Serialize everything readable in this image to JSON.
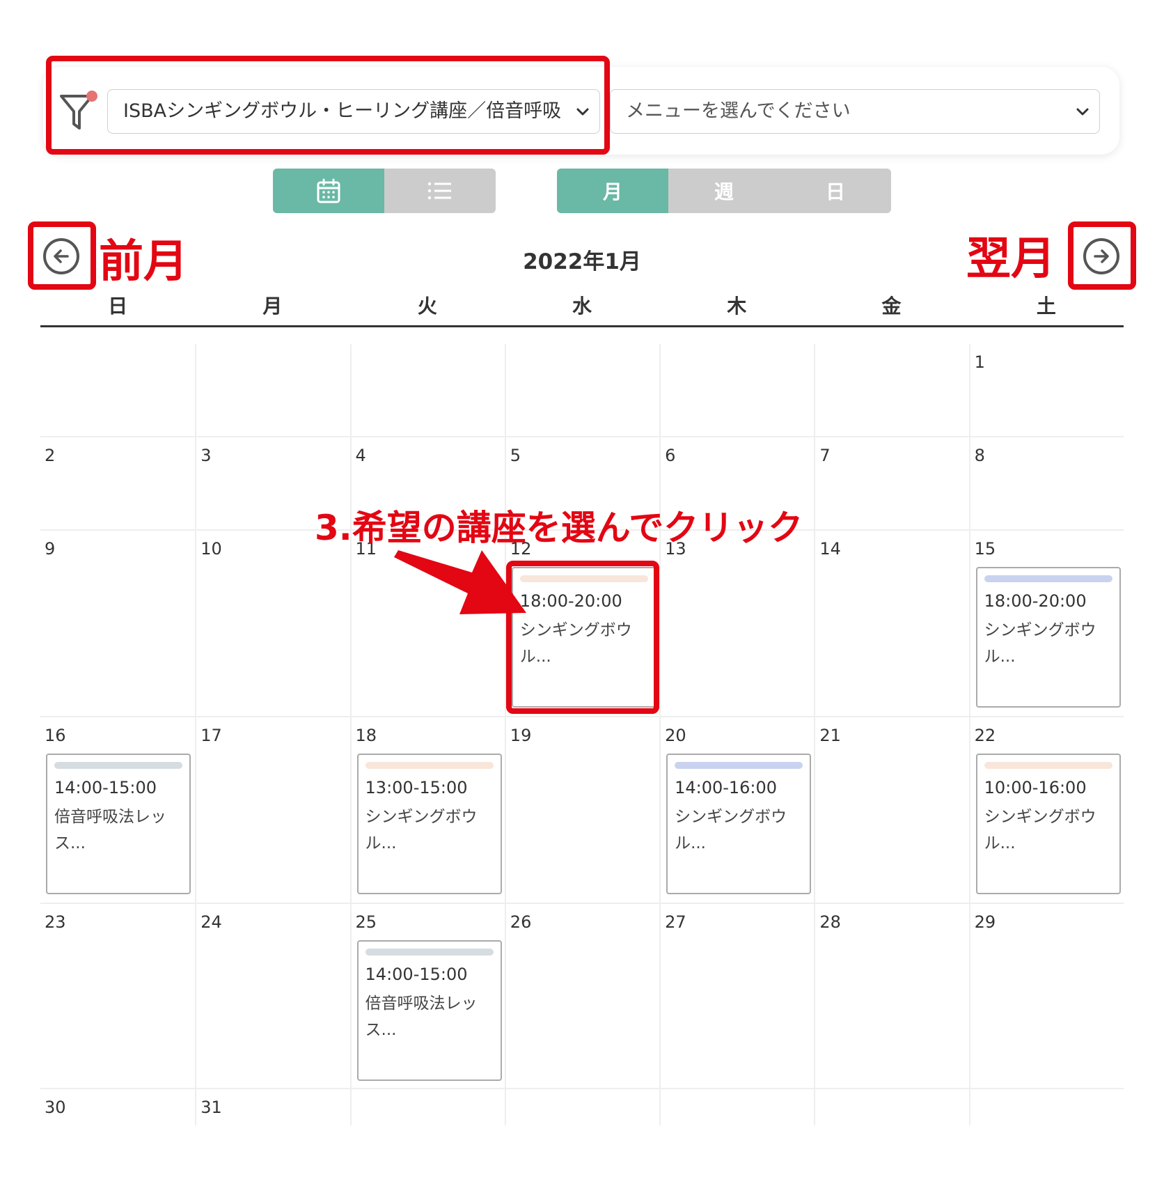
{
  "filter": {
    "course_select_value": "ISBAシンギングボウル・ヒーリング講座／倍音呼吸",
    "menu_select_placeholder": "メニューを選んでください"
  },
  "view_toggle": {
    "calendar_icon": "calendar-icon",
    "list_icon": "list-icon"
  },
  "range_toggle": {
    "month": "月",
    "week": "週",
    "day": "日",
    "active": "月"
  },
  "header": {
    "title": "2022年1月",
    "prev_icon": "arrow-left-circle-icon",
    "next_icon": "arrow-right-circle-icon"
  },
  "weekdays": [
    "日",
    "月",
    "火",
    "水",
    "木",
    "金",
    "土"
  ],
  "colors": {
    "accent": "#6ab8a6",
    "inactive": "#cccccc",
    "annotation": "#e30613",
    "bar_peach": "#f8e6da",
    "bar_blue": "#c9d3f0",
    "bar_gray": "#d6dde0"
  },
  "weeks": [
    [
      "",
      "",
      "",
      "",
      "",
      "",
      "1"
    ],
    [
      "2",
      "3",
      "4",
      "5",
      "6",
      "7",
      "8"
    ],
    [
      "9",
      "10",
      "11",
      "12",
      "13",
      "14",
      "15"
    ],
    [
      "16",
      "17",
      "18",
      "19",
      "20",
      "21",
      "22"
    ],
    [
      "23",
      "24",
      "25",
      "26",
      "27",
      "28",
      "29"
    ],
    [
      "30",
      "31",
      "",
      "",
      "",
      "",
      ""
    ]
  ],
  "events": [
    {
      "week": 2,
      "day": 3,
      "time": "18:00-20:00",
      "title": "シンギングボウル...",
      "color": "#f8e6da"
    },
    {
      "week": 2,
      "day": 6,
      "time": "18:00-20:00",
      "title": "シンギングボウル...",
      "color": "#c9d3f0"
    },
    {
      "week": 3,
      "day": 0,
      "time": "14:00-15:00",
      "title": "倍音呼吸法レッス...",
      "color": "#d6dde0"
    },
    {
      "week": 3,
      "day": 2,
      "time": "13:00-15:00",
      "title": "シンギングボウル...",
      "color": "#f8e6da"
    },
    {
      "week": 3,
      "day": 4,
      "time": "14:00-16:00",
      "title": "シンギングボウル...",
      "color": "#c9d3f0"
    },
    {
      "week": 3,
      "day": 6,
      "time": "10:00-16:00",
      "title": "シンギングボウル...",
      "color": "#f8e6da"
    },
    {
      "week": 4,
      "day": 2,
      "time": "14:00-15:00",
      "title": "倍音呼吸法レッス...",
      "color": "#d6dde0"
    }
  ],
  "annotations": {
    "prev_month": "前月",
    "next_month": "翌月",
    "instruction": "3.希望の講座を選んでクリック"
  }
}
